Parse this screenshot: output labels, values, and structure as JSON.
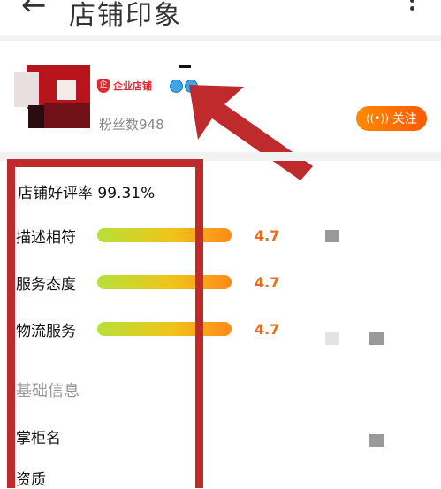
{
  "header": {
    "title": "店铺印象",
    "back_icon": "back-arrow-icon",
    "more_icon": "more-vertical-icon"
  },
  "shop": {
    "badge_label": "企业店铺",
    "fans_text": "粉丝数948",
    "follow_label": "关注"
  },
  "ratings": {
    "good_rate_text": "店铺好评率 99.31%",
    "items": [
      {
        "label": "描述相符",
        "score": "4.7",
        "fill_fraction": 1.0
      },
      {
        "label": "服务态度",
        "score": "4.7",
        "fill_fraction": 1.0
      },
      {
        "label": "物流服务",
        "score": "4.7",
        "fill_fraction": 1.0
      }
    ]
  },
  "basic_info": {
    "section_title": "基础信息",
    "owner_label": "掌柜名",
    "qualification_label": "资质"
  },
  "colors": {
    "accent_orange": "#ff6a00",
    "annotation_red": "#bf2b2d"
  }
}
